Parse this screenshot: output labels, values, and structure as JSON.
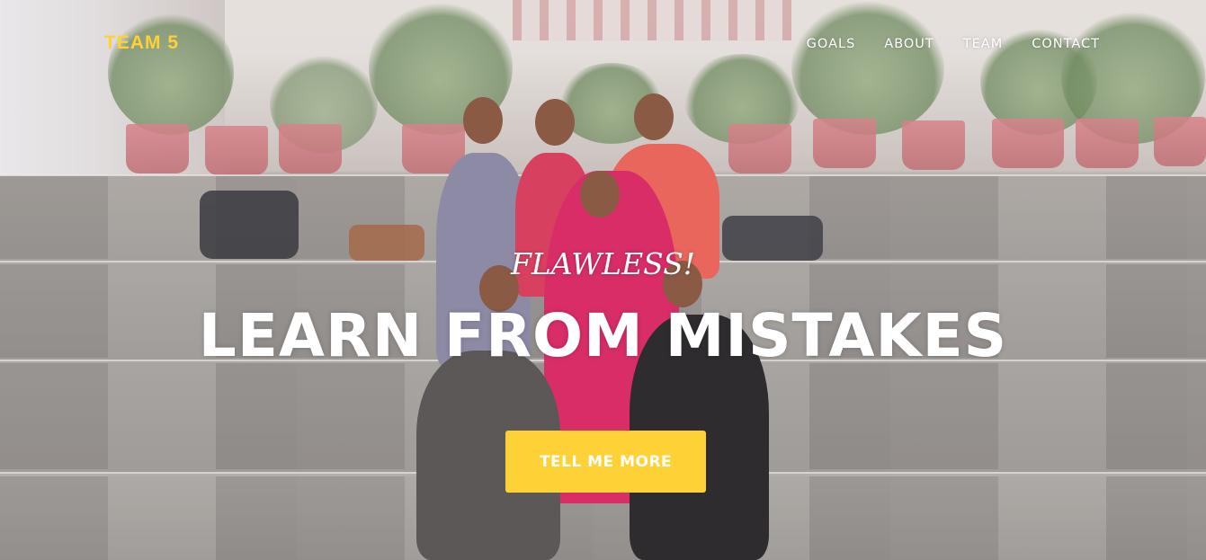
{
  "nav": {
    "brand": "TEAM 5",
    "items": [
      {
        "label": "GOALS"
      },
      {
        "label": "ABOUT"
      },
      {
        "label": "TEAM"
      },
      {
        "label": "CONTACT"
      }
    ]
  },
  "hero": {
    "subheading": "FLAWLESS!",
    "heading": "LEARN FROM MISTAKES",
    "button_label": "TELL ME MORE"
  },
  "colors": {
    "accent": "#fed136",
    "text": "#ffffff"
  }
}
